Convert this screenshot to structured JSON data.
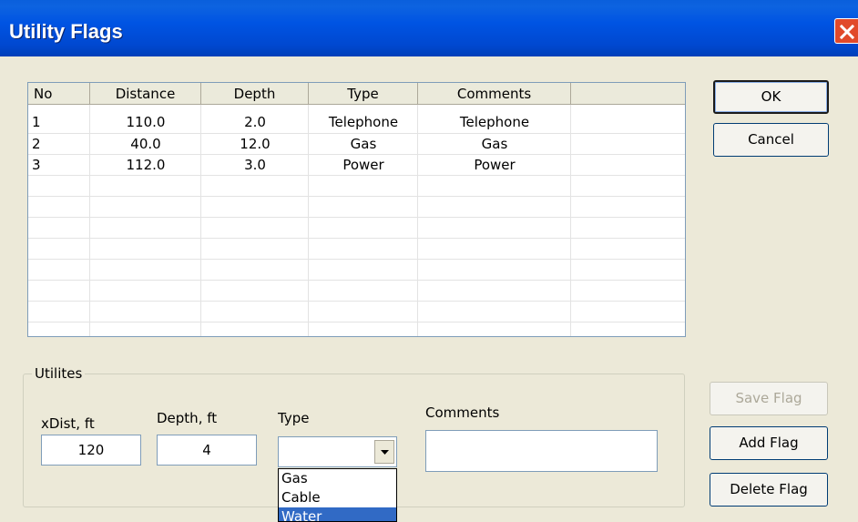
{
  "window": {
    "title": "Utility Flags"
  },
  "table": {
    "columns": [
      "No",
      "Distance",
      "Depth",
      "Type",
      "Comments",
      ""
    ],
    "rows": [
      [
        "1",
        "110.0",
        "2.0",
        "Telephone",
        "Telephone"
      ],
      [
        "2",
        "40.0",
        "12.0",
        "Gas",
        "Gas"
      ],
      [
        "3",
        "112.0",
        "3.0",
        "Power",
        "Power"
      ]
    ]
  },
  "buttons": {
    "ok": "OK",
    "cancel": "Cancel",
    "save_flag": "Save Flag",
    "add_flag": "Add Flag",
    "delete_flag": "Delete Flag"
  },
  "group": {
    "label": "Utilites",
    "xdist_label": "xDist, ft",
    "xdist_value": "120",
    "depth_label": "Depth, ft",
    "depth_value": "4",
    "type_label": "Type",
    "type_value": "",
    "comments_label": "Comments",
    "comments_value": ""
  },
  "dropdown": {
    "options": [
      "Gas",
      "Cable",
      "Water"
    ],
    "highlighted": "Water"
  },
  "colors": {
    "titlebar": "#0054e3",
    "selection": "#316ac5",
    "close": "#e1492a"
  }
}
